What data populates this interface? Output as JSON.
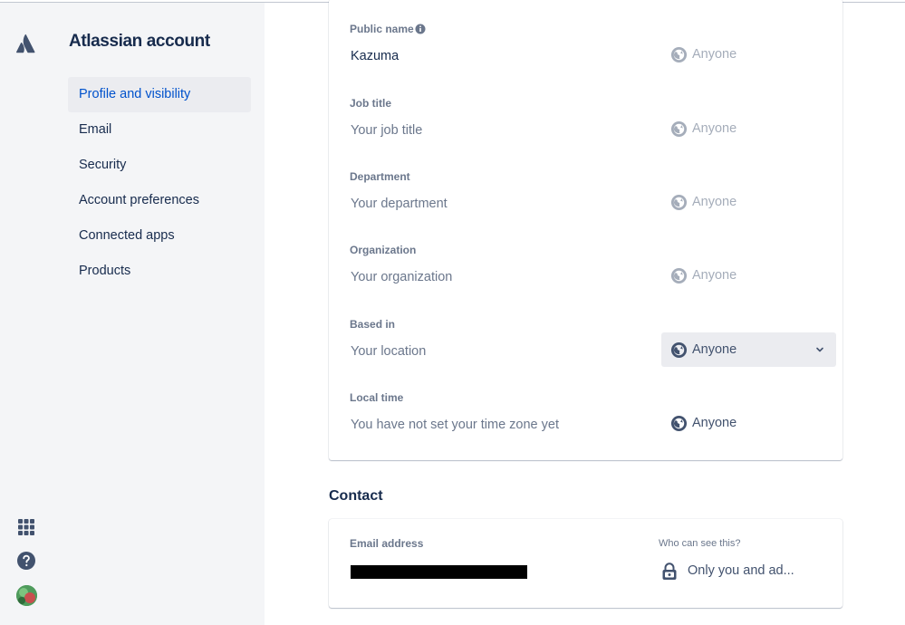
{
  "app": {
    "title": "Atlassian account"
  },
  "rail": {
    "logo_icon": "atlassian-logo-icon",
    "apps_icon": "app-switcher-icon",
    "help_icon": "help-icon",
    "avatar_icon": "user-avatar"
  },
  "sidebar": {
    "items": [
      {
        "label": "Profile and visibility",
        "active": true
      },
      {
        "label": "Email"
      },
      {
        "label": "Security"
      },
      {
        "label": "Account preferences"
      },
      {
        "label": "Connected apps"
      },
      {
        "label": "Products"
      }
    ]
  },
  "about": {
    "fields": [
      {
        "label": "Public name",
        "value": "Kazuma",
        "placeholder": false,
        "visibility": "Anyone",
        "info_icon": true
      },
      {
        "label": "Job title",
        "value": "Your job title",
        "placeholder": true,
        "visibility": "Anyone"
      },
      {
        "label": "Department",
        "value": "Your department",
        "placeholder": true,
        "visibility": "Anyone"
      },
      {
        "label": "Organization",
        "value": "Your organization",
        "placeholder": true,
        "visibility": "Anyone"
      },
      {
        "label": "Based in",
        "value": "Your location",
        "placeholder": true,
        "visibility": "Anyone",
        "dropdown": true
      },
      {
        "label": "Local time",
        "value": "You have not set your time zone yet",
        "placeholder": true,
        "visibility": "Anyone"
      }
    ]
  },
  "contact": {
    "title": "Contact",
    "email_label": "Email address",
    "email_value_redacted": true,
    "who_label": "Who can see this?",
    "visibility": "Only you and ad..."
  },
  "colors": {
    "accent": "#0052cc",
    "text": "#172b4d",
    "subtle": "#6b778c",
    "sidebar_bg": "#f4f5f7",
    "active_bg": "#ebecf0"
  }
}
